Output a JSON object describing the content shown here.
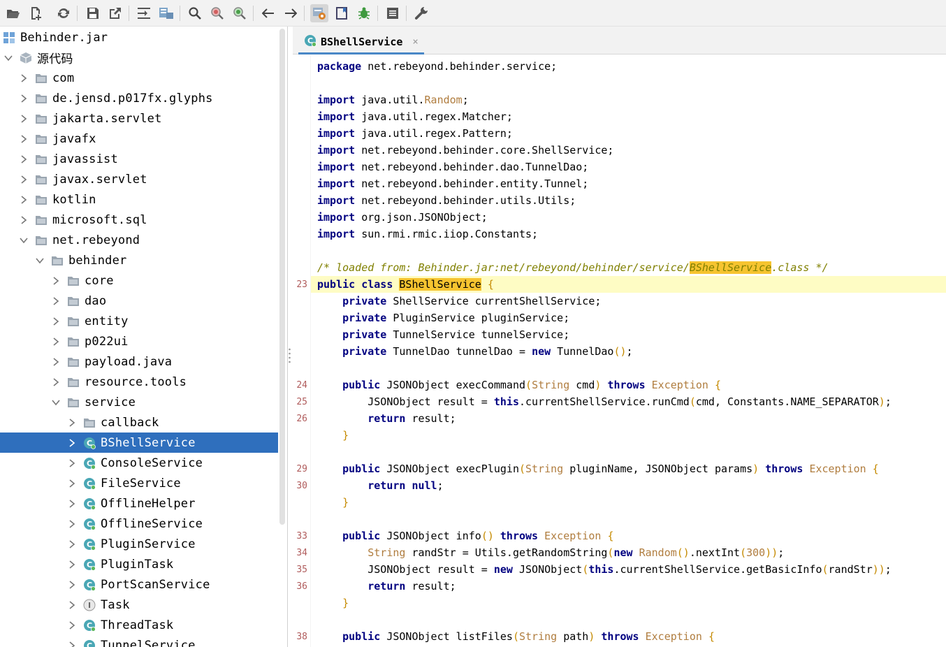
{
  "toolbar": {
    "buttons": [
      {
        "name": "open-folder-icon"
      },
      {
        "name": "add-file-icon"
      },
      {
        "name": "refresh-icon"
      },
      {
        "name": "save-icon"
      },
      {
        "name": "export-icon"
      },
      {
        "name": "wrap-icon"
      },
      {
        "name": "structure-icon"
      },
      {
        "name": "search-icon"
      },
      {
        "name": "find-usage-icon"
      },
      {
        "name": "find-refs-icon"
      },
      {
        "name": "back-icon"
      },
      {
        "name": "forward-icon"
      },
      {
        "name": "decompile-settings-icon"
      },
      {
        "name": "bookmark-icon"
      },
      {
        "name": "bug-icon"
      },
      {
        "name": "log-icon"
      },
      {
        "name": "wrench-icon"
      }
    ]
  },
  "tree": {
    "root": "Behinder.jar",
    "source": "源代码",
    "items": [
      {
        "label": "com",
        "level": 1,
        "kind": "package",
        "expanded": false
      },
      {
        "label": "de.jensd.p017fx.glyphs",
        "level": 1,
        "kind": "package",
        "expanded": false
      },
      {
        "label": "jakarta.servlet",
        "level": 1,
        "kind": "package",
        "expanded": false
      },
      {
        "label": "javafx",
        "level": 1,
        "kind": "package",
        "expanded": false
      },
      {
        "label": "javassist",
        "level": 1,
        "kind": "package",
        "expanded": false
      },
      {
        "label": "javax.servlet",
        "level": 1,
        "kind": "package",
        "expanded": false
      },
      {
        "label": "kotlin",
        "level": 1,
        "kind": "package",
        "expanded": false
      },
      {
        "label": "microsoft.sql",
        "level": 1,
        "kind": "package",
        "expanded": false
      },
      {
        "label": "net.rebeyond",
        "level": 1,
        "kind": "package",
        "expanded": true
      },
      {
        "label": "behinder",
        "level": 2,
        "kind": "package",
        "expanded": true
      },
      {
        "label": "core",
        "level": 3,
        "kind": "package",
        "expanded": false
      },
      {
        "label": "dao",
        "level": 3,
        "kind": "package",
        "expanded": false
      },
      {
        "label": "entity",
        "level": 3,
        "kind": "package",
        "expanded": false
      },
      {
        "label": "p022ui",
        "level": 3,
        "kind": "package",
        "expanded": false
      },
      {
        "label": "payload.java",
        "level": 3,
        "kind": "package",
        "expanded": false
      },
      {
        "label": "resource.tools",
        "level": 3,
        "kind": "package",
        "expanded": false
      },
      {
        "label": "service",
        "level": 3,
        "kind": "package",
        "expanded": true
      },
      {
        "label": "callback",
        "level": 4,
        "kind": "package",
        "expanded": false
      },
      {
        "label": "BShellService",
        "level": 4,
        "kind": "class",
        "expanded": false,
        "selected": true
      },
      {
        "label": "ConsoleService",
        "level": 4,
        "kind": "class",
        "expanded": false
      },
      {
        "label": "FileService",
        "level": 4,
        "kind": "class",
        "expanded": false
      },
      {
        "label": "OfflineHelper",
        "level": 4,
        "kind": "class",
        "expanded": false
      },
      {
        "label": "OfflineService",
        "level": 4,
        "kind": "class",
        "expanded": false
      },
      {
        "label": "PluginService",
        "level": 4,
        "kind": "class",
        "expanded": false
      },
      {
        "label": "PluginTask",
        "level": 4,
        "kind": "class",
        "expanded": false
      },
      {
        "label": "PortScanService",
        "level": 4,
        "kind": "class",
        "expanded": false
      },
      {
        "label": "Task",
        "level": 4,
        "kind": "interface",
        "expanded": false
      },
      {
        "label": "ThreadTask",
        "level": 4,
        "kind": "class",
        "expanded": false
      },
      {
        "label": "TunnelService",
        "level": 4,
        "kind": "class",
        "expanded": false
      }
    ]
  },
  "editor": {
    "tab_title": "BShellService",
    "tab_close": "×",
    "lines": [
      {
        "gutter": "",
        "html": "<span class=\"kw\">package</span> net.rebeyond.behinder.service;"
      },
      {
        "gutter": "",
        "html": ""
      },
      {
        "gutter": "",
        "html": "<span class=\"kw\">import</span> java.util.<span class=\"ty\">Random</span>;"
      },
      {
        "gutter": "",
        "html": "<span class=\"kw\">import</span> java.util.regex.Matcher;"
      },
      {
        "gutter": "",
        "html": "<span class=\"kw\">import</span> java.util.regex.Pattern;"
      },
      {
        "gutter": "",
        "html": "<span class=\"kw\">import</span> net.rebeyond.behinder.core.ShellService;"
      },
      {
        "gutter": "",
        "html": "<span class=\"kw\">import</span> net.rebeyond.behinder.dao.TunnelDao;"
      },
      {
        "gutter": "",
        "html": "<span class=\"kw\">import</span> net.rebeyond.behinder.entity.Tunnel;"
      },
      {
        "gutter": "",
        "html": "<span class=\"kw\">import</span> net.rebeyond.behinder.utils.Utils;"
      },
      {
        "gutter": "",
        "html": "<span class=\"kw\">import</span> org.json.JSONObject;"
      },
      {
        "gutter": "",
        "html": "<span class=\"kw\">import</span> sun.rmi.rmic.iiop.Constants;"
      },
      {
        "gutter": "",
        "html": ""
      },
      {
        "gutter": "",
        "html": "<span class=\"cmt\">/* loaded from: Behinder.jar:net/rebeyond/behinder/service/<span class=\"mark\">BShellService</span>.class */</span>"
      },
      {
        "gutter": "23",
        "hl": true,
        "html": "<span class=\"kw\">public</span> <span class=\"kw\">class</span> <span class=\"mark\">BShellService</span> <span class=\"br\">{</span>"
      },
      {
        "gutter": "",
        "html": "    <span class=\"kw\">private</span> ShellService currentShellService;"
      },
      {
        "gutter": "",
        "html": "    <span class=\"kw\">private</span> PluginService pluginService;"
      },
      {
        "gutter": "",
        "html": "    <span class=\"kw\">private</span> TunnelService tunnelService;"
      },
      {
        "gutter": "",
        "html": "    <span class=\"kw\">private</span> TunnelDao tunnelDao = <span class=\"kw\">new</span> TunnelDao<span class=\"br\">()</span>;"
      },
      {
        "gutter": "",
        "html": ""
      },
      {
        "gutter": "24",
        "html": "    <span class=\"kw\">public</span> JSONObject execCommand<span class=\"br\">(</span><span class=\"ty\">String</span> cmd<span class=\"br\">)</span> <span class=\"kw\">throws</span> <span class=\"ty\">Exception</span> <span class=\"br\">{</span>"
      },
      {
        "gutter": "25",
        "html": "        JSONObject result = <span class=\"kw\">this</span>.currentShellService.runCmd<span class=\"br\">(</span>cmd, Constants.NAME_SEPARATOR<span class=\"br\">)</span>;"
      },
      {
        "gutter": "26",
        "html": "        <span class=\"kw\">return</span> result;"
      },
      {
        "gutter": "",
        "html": "    <span class=\"br\">}</span>"
      },
      {
        "gutter": "",
        "html": ""
      },
      {
        "gutter": "29",
        "html": "    <span class=\"kw\">public</span> JSONObject execPlugin<span class=\"br\">(</span><span class=\"ty\">String</span> pluginName, JSONObject params<span class=\"br\">)</span> <span class=\"kw\">throws</span> <span class=\"ty\">Exception</span> <span class=\"br\">{</span>"
      },
      {
        "gutter": "30",
        "html": "        <span class=\"kw\">return</span> <span class=\"kw\">null</span>;"
      },
      {
        "gutter": "",
        "html": "    <span class=\"br\">}</span>"
      },
      {
        "gutter": "",
        "html": ""
      },
      {
        "gutter": "33",
        "html": "    <span class=\"kw\">public</span> JSONObject info<span class=\"br\">()</span> <span class=\"kw\">throws</span> <span class=\"ty\">Exception</span> <span class=\"br\">{</span>"
      },
      {
        "gutter": "34",
        "html": "        <span class=\"ty\">String</span> randStr = Utils.getRandomString<span class=\"br\">(</span><span class=\"kw\">new</span> <span class=\"ty\">Random</span><span class=\"br\">()</span>.nextInt<span class=\"br\">(</span><span class=\"num\">300</span><span class=\"br\">))</span>;"
      },
      {
        "gutter": "35",
        "html": "        JSONObject result = <span class=\"kw\">new</span> JSONObject<span class=\"br\">(</span><span class=\"kw\">this</span>.currentShellService.getBasicInfo<span class=\"br\">(</span>randStr<span class=\"br\">))</span>;"
      },
      {
        "gutter": "36",
        "html": "        <span class=\"kw\">return</span> result;"
      },
      {
        "gutter": "",
        "html": "    <span class=\"br\">}</span>"
      },
      {
        "gutter": "",
        "html": ""
      },
      {
        "gutter": "38",
        "html": "    <span class=\"kw\">public</span> JSONObject listFiles<span class=\"br\">(</span><span class=\"ty\">String</span> path<span class=\"br\">)</span> <span class=\"kw\">throws</span> <span class=\"ty\">Exception</span> <span class=\"br\">{</span>"
      }
    ]
  }
}
